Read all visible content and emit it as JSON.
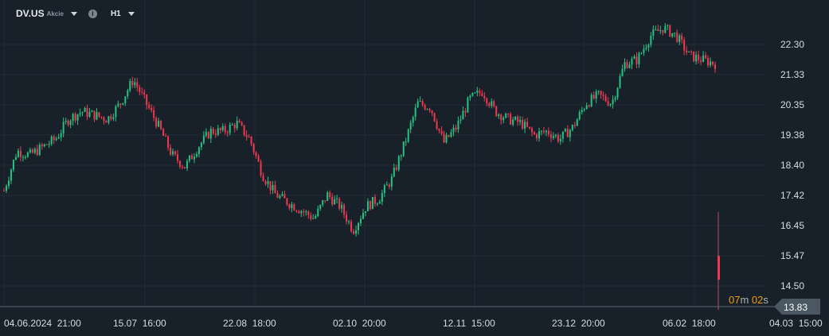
{
  "header": {
    "symbol": "DV.US",
    "type": "Akcie",
    "timeframe": "H1",
    "info_icon": "info-icon"
  },
  "countdown": {
    "minutes": "07",
    "m": "m",
    "seconds": "02",
    "s": "s"
  },
  "colors": {
    "bg": "#18212a",
    "up": "#26c281",
    "down": "#f0394f",
    "grid": "#222c36",
    "text": "#d6dbe0",
    "countdown": "#f39c12"
  },
  "chart_data": {
    "type": "candlestick",
    "title": "DV.US H1",
    "y_ticks": [
      "22.30",
      "21.33",
      "20.35",
      "19.38",
      "18.40",
      "17.42",
      "16.45",
      "15.47",
      "14.50"
    ],
    "ylim": [
      13.5,
      23.0
    ],
    "x_ticks": [
      "04.06.2024  21:00",
      "15.07  16:00",
      "22.08  18:00",
      "02.10  20:00",
      "12.11  15:00",
      "23.12  20:00",
      "06.02  18:00",
      "04.03  15:00"
    ],
    "current_price": "13.83",
    "hidden_tick": "13.52",
    "close_path": [
      17.58,
      18.86,
      18.73,
      18.99,
      19.25,
      19.89,
      20.14,
      20.02,
      19.89,
      20.4,
      21.17,
      20.4,
      19.63,
      18.73,
      18.35,
      18.99,
      19.5,
      19.5,
      19.76,
      19.25,
      18.09,
      17.45,
      17.19,
      16.94,
      16.68,
      17.45,
      17.07,
      16.3,
      17.07,
      17.32,
      17.96,
      19.12,
      20.4,
      20.27,
      19.12,
      19.63,
      20.53,
      20.79,
      20.14,
      19.89,
      19.76,
      19.37,
      19.5,
      19.25,
      19.63,
      20.4,
      20.66,
      20.4,
      21.68,
      21.81,
      22.58,
      22.84,
      22.58,
      21.94,
      21.81,
      21.68
    ],
    "last_candle": {
      "open": 15.47,
      "high": 16.89,
      "low": 13.83,
      "close": 14.7
    }
  }
}
